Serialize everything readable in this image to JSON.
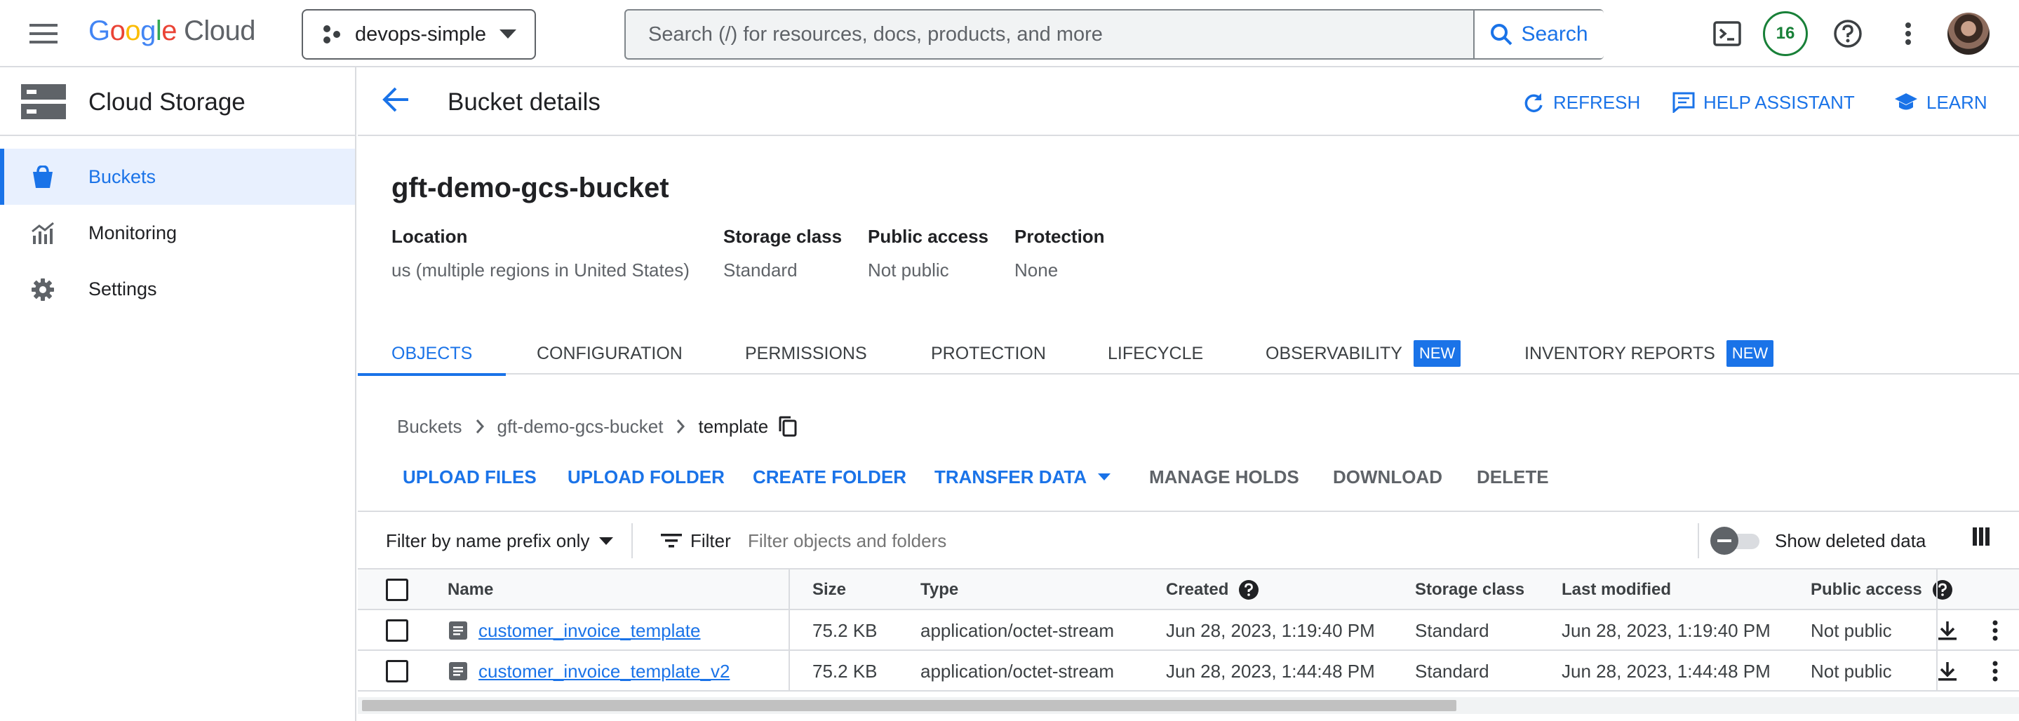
{
  "topbar": {
    "logo": {
      "letters": [
        "G",
        "o",
        "o",
        "g",
        "l",
        "e"
      ],
      "suffix": "Cloud"
    },
    "project": "devops-simple",
    "search_placeholder": "Search (/) for resources, docs, products, and more",
    "search_button": "Search",
    "notifications_count": "16"
  },
  "sidebar": {
    "title": "Cloud Storage",
    "items": [
      {
        "label": "Buckets",
        "icon": "bucket-icon",
        "active": true
      },
      {
        "label": "Monitoring",
        "icon": "monitoring-chart-icon",
        "active": false
      },
      {
        "label": "Settings",
        "icon": "gear-icon",
        "active": false
      }
    ]
  },
  "header": {
    "title": "Bucket details",
    "refresh": "REFRESH",
    "help_assistant": "HELP ASSISTANT",
    "learn": "LEARN"
  },
  "bucket": {
    "name": "gft-demo-gcs-bucket",
    "properties": [
      {
        "label": "Location",
        "value": "us (multiple regions in United States)"
      },
      {
        "label": "Storage class",
        "value": "Standard"
      },
      {
        "label": "Public access",
        "value": "Not public"
      },
      {
        "label": "Protection",
        "value": "None"
      }
    ]
  },
  "tabs": [
    {
      "label": "OBJECTS",
      "active": true,
      "badge": ""
    },
    {
      "label": "CONFIGURATION",
      "active": false,
      "badge": ""
    },
    {
      "label": "PERMISSIONS",
      "active": false,
      "badge": ""
    },
    {
      "label": "PROTECTION",
      "active": false,
      "badge": ""
    },
    {
      "label": "LIFECYCLE",
      "active": false,
      "badge": ""
    },
    {
      "label": "OBSERVABILITY",
      "active": false,
      "badge": "NEW"
    },
    {
      "label": "INVENTORY REPORTS",
      "active": false,
      "badge": "NEW"
    }
  ],
  "breadcrumb": [
    "Buckets",
    "gft-demo-gcs-bucket",
    "template"
  ],
  "toolbar": {
    "upload_files": "UPLOAD FILES",
    "upload_folder": "UPLOAD FOLDER",
    "create_folder": "CREATE FOLDER",
    "transfer_data": "TRANSFER DATA",
    "manage_holds": "MANAGE HOLDS",
    "download": "DOWNLOAD",
    "delete": "DELETE"
  },
  "filter": {
    "mode": "Filter by name prefix only",
    "filter_label": "Filter",
    "placeholder": "Filter objects and folders",
    "show_deleted": "Show deleted data"
  },
  "table": {
    "columns": [
      "Name",
      "Size",
      "Type",
      "Created",
      "Storage class",
      "Last modified",
      "Public access"
    ],
    "rows": [
      {
        "name": "customer_invoice_template",
        "size": "75.2 KB",
        "type": "application/octet-stream",
        "created": "Jun 28, 2023, 1:19:40 PM",
        "storage_class": "Standard",
        "last_modified": "Jun 28, 2023, 1:19:40 PM",
        "public_access": "Not public"
      },
      {
        "name": "customer_invoice_template_v2",
        "size": "75.2 KB",
        "type": "application/octet-stream",
        "created": "Jun 28, 2023, 1:44:48 PM",
        "storage_class": "Standard",
        "last_modified": "Jun 28, 2023, 1:44:48 PM",
        "public_access": "Not public"
      }
    ]
  },
  "colors": {
    "accent": "#1a73e8",
    "logo": [
      "#4285f4",
      "#ea4335",
      "#fbbc04",
      "#4285f4",
      "#34a853",
      "#ea4335"
    ],
    "badge_green": "#188038"
  }
}
